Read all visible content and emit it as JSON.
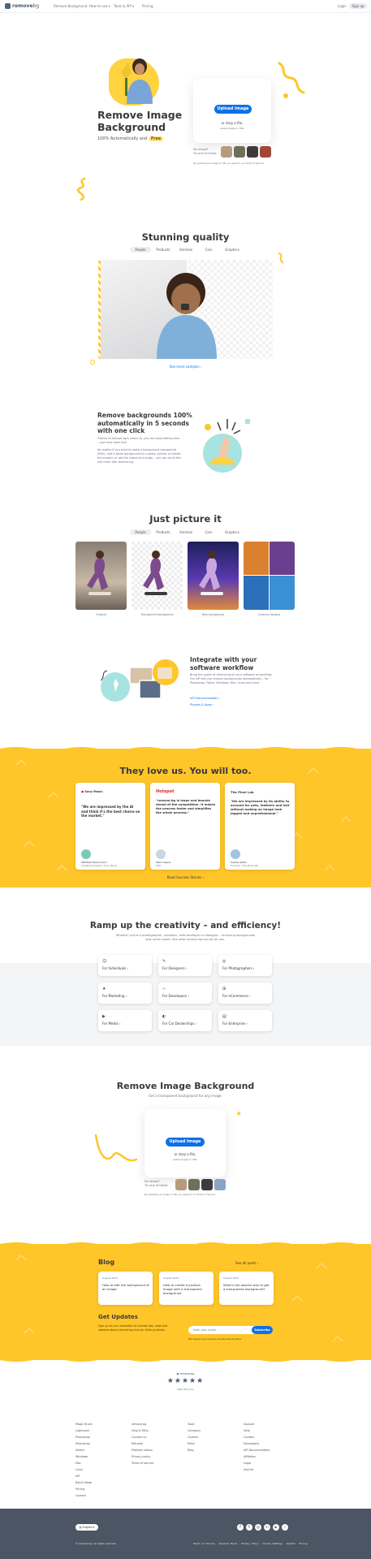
{
  "nav": {
    "logo": "remove",
    "logo_suffix": "bg",
    "items": [
      "Remove Background",
      "How to use",
      "Tools & API",
      "Pricing"
    ],
    "login": "Login",
    "signup": "Sign up"
  },
  "hero": {
    "title_line1": "Remove Image",
    "title_line2": "Background",
    "subtitle": "100% Automatically and",
    "badge": "Free",
    "upload_button": "Upload Image",
    "drop_text": "or drop a file,",
    "paste_text": "paste image or URL",
    "no_image": "No image?",
    "try_one": "Try one of these:",
    "terms": "By uploading an image or URL you agree to our Terms of Service."
  },
  "quality": {
    "title": "Stunning quality",
    "tabs": [
      "People",
      "Products",
      "Animals",
      "Cars",
      "Graphics"
    ],
    "link": "See more samples"
  },
  "feature1": {
    "title_lines": [
      "Remove backgrounds 100%",
      "automatically in 5 seconds",
      "with one click"
    ],
    "para1": "Thanks to remove.bg's clever AI, you can slash editing time – and have more fun!",
    "para2": "No matter if you want to make a background transparent (PNG), add a white background to a photo, extract or isolate the subject, or get the cutout of a photo – you can do all this and more with remove.bg."
  },
  "picture": {
    "title": "Just picture it",
    "tabs": [
      "People",
      "Products",
      "Animals",
      "Cars",
      "Graphics"
    ],
    "captions": [
      "Original",
      "Transparent background",
      "New background",
      "Creative designs"
    ]
  },
  "integrate": {
    "title_line1": "Integrate with your",
    "title_line2": "software workflow",
    "body": "Bring the power of remove.bg to your software or workflow. Our API lets you remove backgrounds automatically – for Photoshop, Figma, Windows, Mac, Linux and more.",
    "link1": "API Documentation",
    "link2": "Plugins & Apps"
  },
  "testimonials": {
    "title": "They love us. You will too.",
    "cards": [
      {
        "logo": "Sony Music",
        "quote": "\"We are impressed by the AI and think it's the best choice on the market.\"",
        "name": "Matthias Bickermann",
        "role": "Creative Director, Sony Music"
      },
      {
        "logo": "Hotspot",
        "quote": "\"remove.bg is leaps and bounds ahead of the competition. It makes the process faster and simplifies the whole process.\"",
        "name": "Mark Owens",
        "role": "CEO"
      },
      {
        "logo": "The Pixel Lab",
        "quote": "\"We are impressed by its ability to account for pets, feathers and hair without making an image look jagged and unprofessional.\"",
        "name": "Sophia Gibbs",
        "role": "Founder, The Pixel Lab"
      }
    ],
    "link": "Read Success Stories"
  },
  "efficiency": {
    "title": "Ramp up the creativity – and efficiency!",
    "desc_line1": "Whether you're a photographer, marketer, web developer or designer – removing backgrounds",
    "desc_line2": "was never easier. See what remove.bg can do for you.",
    "items": [
      "For Individuals",
      "For Photographers",
      "For Marketing",
      "For Developers",
      "For eCommerce",
      "For Media",
      "For Car Dealerships",
      "For Enterprise",
      "For Designers"
    ]
  },
  "cta": {
    "title": "Remove Image Background",
    "subtitle": "Get a transparent background for any image.",
    "upload_button": "Upload Image",
    "drop_text": "or drop a file,",
    "paste_text": "paste image or URL",
    "no_image": "No image?",
    "try_one": "Try one of these:",
    "terms": "By uploading an image or URL you agree to our Terms of Service."
  },
  "blog": {
    "title": "Blog",
    "all_posts": "See all posts",
    "posts": [
      {
        "date": "August 2023",
        "title": "How to edit the background of an image"
      },
      {
        "date": "August 2023",
        "title": "How to create a product image with a transparent background"
      },
      {
        "date": "August 2023",
        "title": "What's the easiest way to get a transparent background?"
      }
    ],
    "updates_title": "Get Updates",
    "updates_body": "Sign up for our newsletter to receive tips, news and updates about remove.bg and our other products.",
    "email_placeholder": "Enter your e-mail",
    "subscribe": "Subscribe",
    "privacy": "We respect your privacy. Unsubscribe anytime."
  },
  "rating": {
    "brand": "remove.bg",
    "text": "Rate this tool",
    "stars": 5
  },
  "footer_links": {
    "col1": [
      "Magic Brush",
      "Lightroom",
      "Photoshop",
      "Photoshop",
      "Sketch",
      "Windows",
      "Mac",
      "Linux",
      "API",
      "Batch Mode",
      "Pricing",
      "Careers"
    ],
    "col2": [
      "remove.bg",
      "Help & FAQs",
      "Contact us",
      "Refunds",
      "Platform status",
      "Privacy policy",
      "Terms of service"
    ],
    "col3": [
      "Tools",
      "Company",
      "Careers",
      "Press",
      "Blog"
    ],
    "col4": [
      "Support",
      "Help",
      "Contact",
      "Developers",
      "API Documentation",
      "Affiliates",
      "Legal",
      "Imprint"
    ]
  },
  "footer": {
    "language": "English",
    "copyright": "© remove.bg. All rights reserved.",
    "bottom_links": [
      "Terms of Service",
      "General Terms",
      "Privacy Policy",
      "Cookie Settings",
      "Imprint",
      "Pricing"
    ]
  },
  "colors": {
    "accent": "#0f70e6",
    "yellow": "#ffc629",
    "footer_bg": "#4b5563"
  }
}
